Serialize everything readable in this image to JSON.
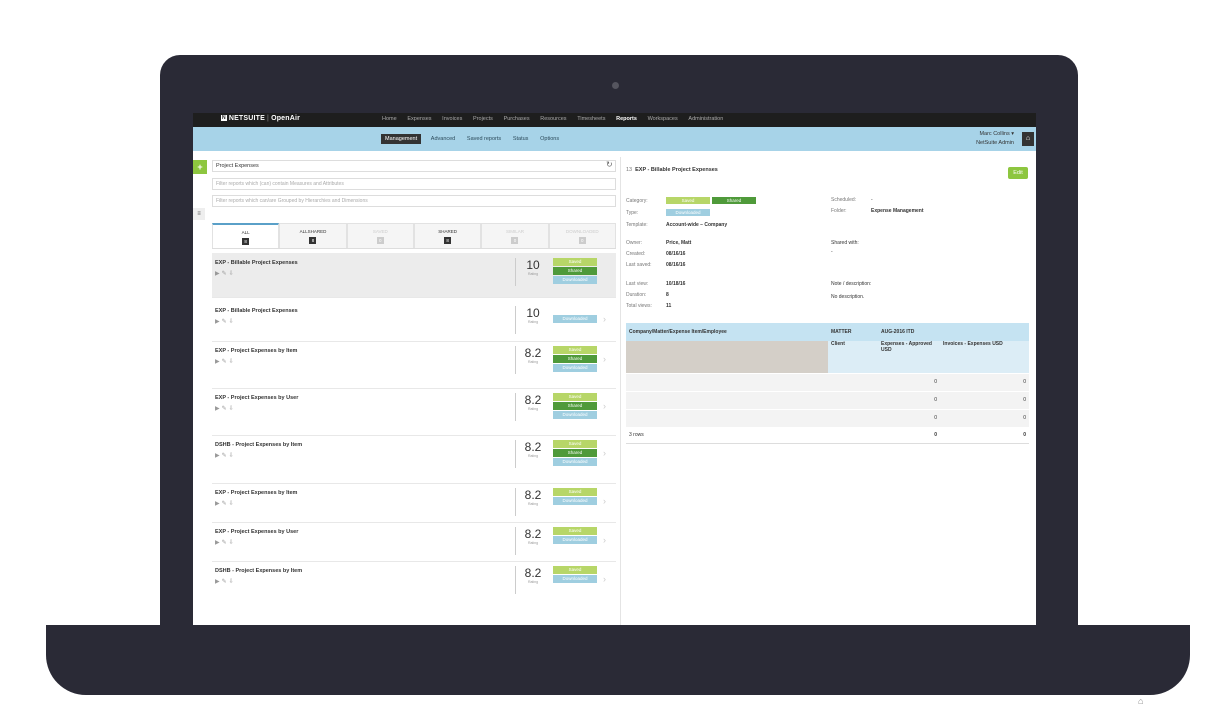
{
  "topbar": {
    "logo_netsuite": "NETSUITE",
    "logo_openair": "OpenAir",
    "nav": [
      "Home",
      "Expenses",
      "Invoices",
      "Projects",
      "Purchases",
      "Resources",
      "Timesheets",
      "Reports",
      "Workspaces",
      "Administration"
    ],
    "active_nav": "Reports"
  },
  "subbar": {
    "items": [
      "Management",
      "Advanced",
      "Saved reports",
      "Status",
      "Options"
    ],
    "active": "Management",
    "user_name": "Marc Collins ▾",
    "user_role": "NetSuite Admin"
  },
  "left": {
    "search_value": "Project Expenses",
    "filter_measures_placeholder": "Filter reports which (can) contain Measures and Attributes",
    "filter_dimensions_placeholder": "Filter reports which can/are Grouped by Hierarchies and Dimensions",
    "tabs": [
      {
        "label": "ALL",
        "count": "8"
      },
      {
        "label": "ALLSHARED",
        "count": "8"
      },
      {
        "label": "SAVED",
        "count": "0"
      },
      {
        "label": "SHARED",
        "count": "8"
      },
      {
        "label": "SIMILAR",
        "count": "0"
      },
      {
        "label": "DOWNLOADED",
        "count": "0"
      }
    ],
    "rating_label": "Rating",
    "reports": [
      {
        "title": "EXP - Billable Project Expenses",
        "rating": "10",
        "badges": [
          "Saved",
          "Shared",
          "Downloaded"
        ]
      },
      {
        "title": "EXP - Billable Project Expenses",
        "rating": "10",
        "badges": [
          "Downloaded"
        ]
      },
      {
        "title": "EXP - Project Expenses by Item",
        "rating": "8.2",
        "badges": [
          "Saved",
          "Shared",
          "Downloaded"
        ]
      },
      {
        "title": "EXP - Project Expenses by User",
        "rating": "8.2",
        "badges": [
          "Saved",
          "Shared",
          "Downloaded"
        ]
      },
      {
        "title": "DSHB - Project Expenses by Item",
        "rating": "8.2",
        "badges": [
          "Saved",
          "Shared",
          "Downloaded"
        ]
      },
      {
        "title": "EXP - Project Expenses by Item",
        "rating": "8.2",
        "badges": [
          "Saved",
          "Downloaded"
        ]
      },
      {
        "title": "EXP - Project Expenses by User",
        "rating": "8.2",
        "badges": [
          "Saved",
          "Downloaded"
        ]
      },
      {
        "title": "DSHB - Project Expenses by Item",
        "rating": "8.2",
        "badges": [
          "Saved",
          "Downloaded"
        ]
      }
    ]
  },
  "detail": {
    "id": "13",
    "title": "EXP - Billable Project Expenses",
    "edit_label": "Edit",
    "category_label": "Category:",
    "category_badges": [
      "Saved",
      "Shared"
    ],
    "type_label": "Type:",
    "type_badge": "Downloaded",
    "template_label": "Template:",
    "template_value": "Account-wide – Company",
    "owner_label": "Owner:",
    "owner_value": "Price, Matt",
    "created_label": "Created:",
    "created_value": "08/16/16",
    "last_saved_label": "Last saved:",
    "last_saved_value": "08/16/16",
    "last_view_label": "Last view:",
    "last_view_value": "10/18/16",
    "duration_label": "Duration:",
    "duration_value": "8",
    "total_views_label": "Total views:",
    "total_views_value": "11",
    "scheduled_label": "Scheduled:",
    "scheduled_value": "-",
    "folder_label": "Folder:",
    "folder_value": "Expense Management",
    "shared_with_label": "Shared with:",
    "shared_with_value": "-",
    "note_label": "Note / description:",
    "note_value": "No description.",
    "grid": {
      "col1": "Company/Matter/Expense Item/Employee",
      "col2": "MATTER",
      "col3": "AUG-2016 ITD",
      "sub_client": "Client",
      "sub_expenses": "Expenses - Approved USD",
      "sub_invoices": "Invoices - Expenses USD",
      "rows": [
        {
          "a": "0",
          "b": "0"
        },
        {
          "a": "0",
          "b": "0"
        },
        {
          "a": "0",
          "b": "0"
        }
      ],
      "footer_label": "3 rows",
      "footer_a": "0",
      "footer_b": "0"
    }
  },
  "colors": {
    "accent_green": "#8dc63f",
    "shared_green": "#4f9a3a",
    "downloaded_blue": "#9fcee0",
    "subbar_blue": "#a7d3e8"
  }
}
